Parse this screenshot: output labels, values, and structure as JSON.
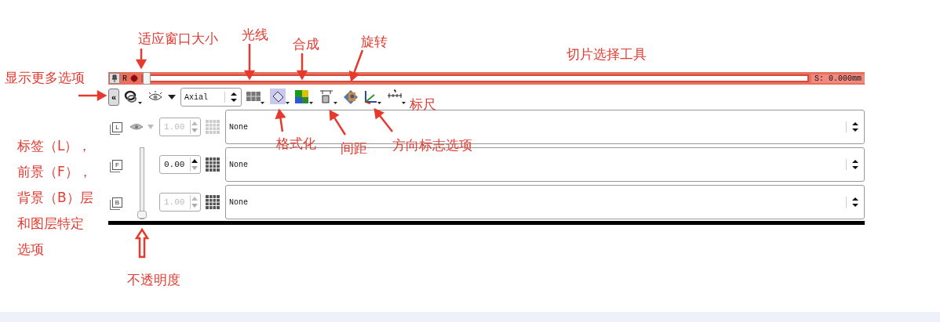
{
  "callouts": [
    {
      "text": "适应窗口大小"
    },
    {
      "text": "光线"
    },
    {
      "text": "合成"
    },
    {
      "text": "旋转"
    },
    {
      "text": "切片选择工具"
    },
    {
      "text": "显示更多选项"
    },
    {
      "text": "标尺"
    },
    {
      "text": "格式化"
    },
    {
      "text": "间距"
    },
    {
      "text": "方向标志选项"
    },
    {
      "text": "不透明度"
    }
  ],
  "layer_note": {
    "lines": [
      "标签（L），",
      "前景（F），",
      "背景（B）层",
      "和图层特定",
      "选项"
    ]
  },
  "slice_bar": {
    "orientation": "R",
    "offset": "S: 0.000mm",
    "level": 0
  },
  "toolbar": {
    "collapse": "«",
    "view": "Axial"
  },
  "opacity_slider": {
    "level": 0
  },
  "layers": [
    {
      "kind": "label",
      "letter": "L",
      "opacity": "1.00",
      "disabled": true,
      "volume": "None"
    },
    {
      "kind": "foreground",
      "letter": "F",
      "opacity": "0.00",
      "disabled": false,
      "volume": "None"
    },
    {
      "kind": "background",
      "letter": "B",
      "opacity": "1.00",
      "disabled": true,
      "volume": "None"
    }
  ]
}
